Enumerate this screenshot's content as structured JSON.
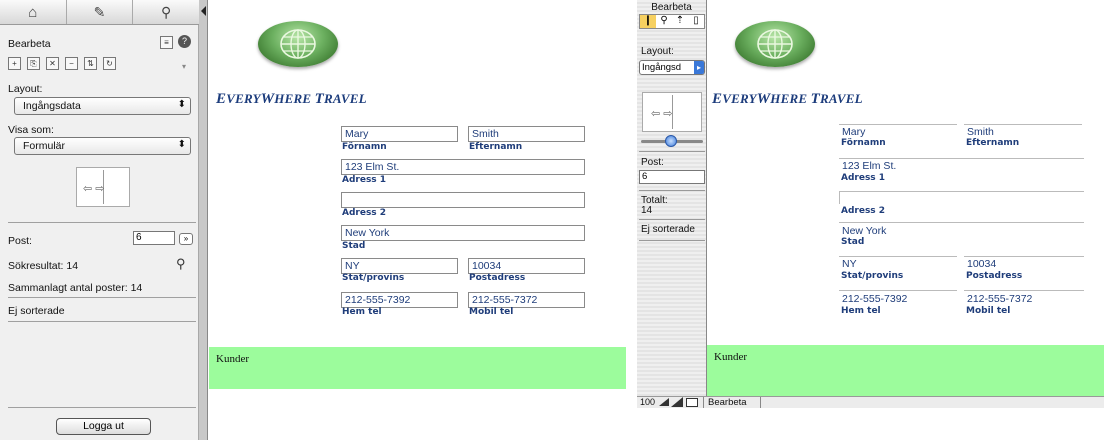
{
  "left": {
    "mode_label": "Bearbeta",
    "layout_label": "Layout:",
    "layout_value": "Ingångsdata",
    "visa_label": "Visa som:",
    "visa_value": "Formulär",
    "post_label": "Post:",
    "post_value": "6",
    "sok_label": "Sökresultat: 14",
    "total_label": "Sammanlagt antal poster: 14",
    "sort_label": "Ej sorterade",
    "logout_label": "Logga ut",
    "icons": [
      "home-icon",
      "pencil-icon",
      "search-icon"
    ]
  },
  "right": {
    "mode_label": "Bearbeta",
    "layout_label": "Layout:",
    "layout_value": "Ingångsd",
    "post_label": "Post:",
    "post_value": "6",
    "total_label": "Totalt:",
    "total_value": "14",
    "sort_label": "Ej sorterade",
    "zoom_value": "100",
    "status_mode": "Bearbeta"
  },
  "brand": "EveryWhere Travel",
  "record": {
    "first_name": "Mary",
    "last_name": "Smith",
    "address1": "123 Elm St.",
    "address2": "",
    "city": "New York",
    "state": "NY",
    "zip": "10034",
    "home_phone": "212-555-7392",
    "mobile_phone": "212-555-7372"
  },
  "labels": {
    "first_name": "Förnamn",
    "last_name": "Efternamn",
    "address1": "Adress 1",
    "address2": "Adress 2",
    "city": "Stad",
    "state": "Stat/provins",
    "zip": "Postadress",
    "home_phone": "Hem tel",
    "mobile_phone": "Mobil tel"
  },
  "footer_label": "Kunder",
  "colors": {
    "footer": "#9cfc9c",
    "field_text": "#1f3d7a",
    "brand": "#1c3c7c"
  }
}
